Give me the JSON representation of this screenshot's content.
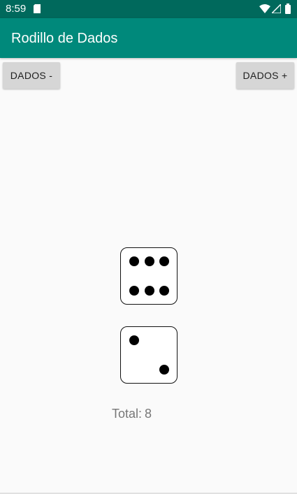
{
  "status_bar": {
    "time": "8:59",
    "icons": [
      "sim-card-icon",
      "wifi-icon",
      "signal-icon",
      "battery-icon"
    ]
  },
  "app_bar": {
    "title": "Rodillo de Dados",
    "color": "#00897b"
  },
  "buttons": {
    "remove_dice": "DADOS -",
    "add_dice": "DADOS +"
  },
  "dice": [
    {
      "value": 6
    },
    {
      "value": 2
    }
  ],
  "total": {
    "label": "Total:",
    "value": "8"
  },
  "colors": {
    "status_bar": "#00695c",
    "app_bar": "#00897b",
    "background": "#fafafa",
    "button": "#d6d6d6"
  }
}
